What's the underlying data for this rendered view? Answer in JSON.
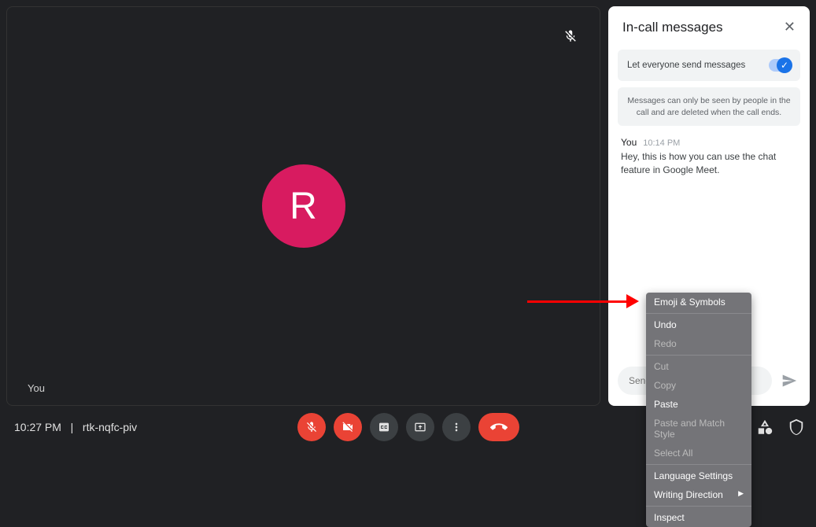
{
  "video": {
    "avatar_letter": "R",
    "you_label": "You"
  },
  "bottom": {
    "time": "10:27 PM",
    "separator": "|",
    "code": "rtk-nqfc-piv"
  },
  "chat": {
    "title": "In-call messages",
    "toggle_label": "Let everyone send messages",
    "notice": "Messages can only be seen by people in the call and are deleted when the call ends.",
    "message": {
      "sender": "You",
      "time": "10:14 PM",
      "body": "Hey, this is how you can use the chat feature in Google Meet."
    },
    "input_placeholder": "Send a message"
  },
  "context_menu": {
    "items": [
      {
        "label": "Emoji & Symbols",
        "enabled": true
      },
      {
        "sep": true
      },
      {
        "label": "Undo",
        "enabled": true
      },
      {
        "label": "Redo",
        "enabled": false
      },
      {
        "sep": true
      },
      {
        "label": "Cut",
        "enabled": false
      },
      {
        "label": "Copy",
        "enabled": false
      },
      {
        "label": "Paste",
        "enabled": true
      },
      {
        "label": "Paste and Match Style",
        "enabled": false
      },
      {
        "label": "Select All",
        "enabled": false
      },
      {
        "sep": true
      },
      {
        "label": "Language Settings",
        "enabled": true
      },
      {
        "label": "Writing Direction",
        "enabled": true,
        "submenu": true
      },
      {
        "sep": true
      },
      {
        "label": "Inspect",
        "enabled": true
      }
    ]
  }
}
